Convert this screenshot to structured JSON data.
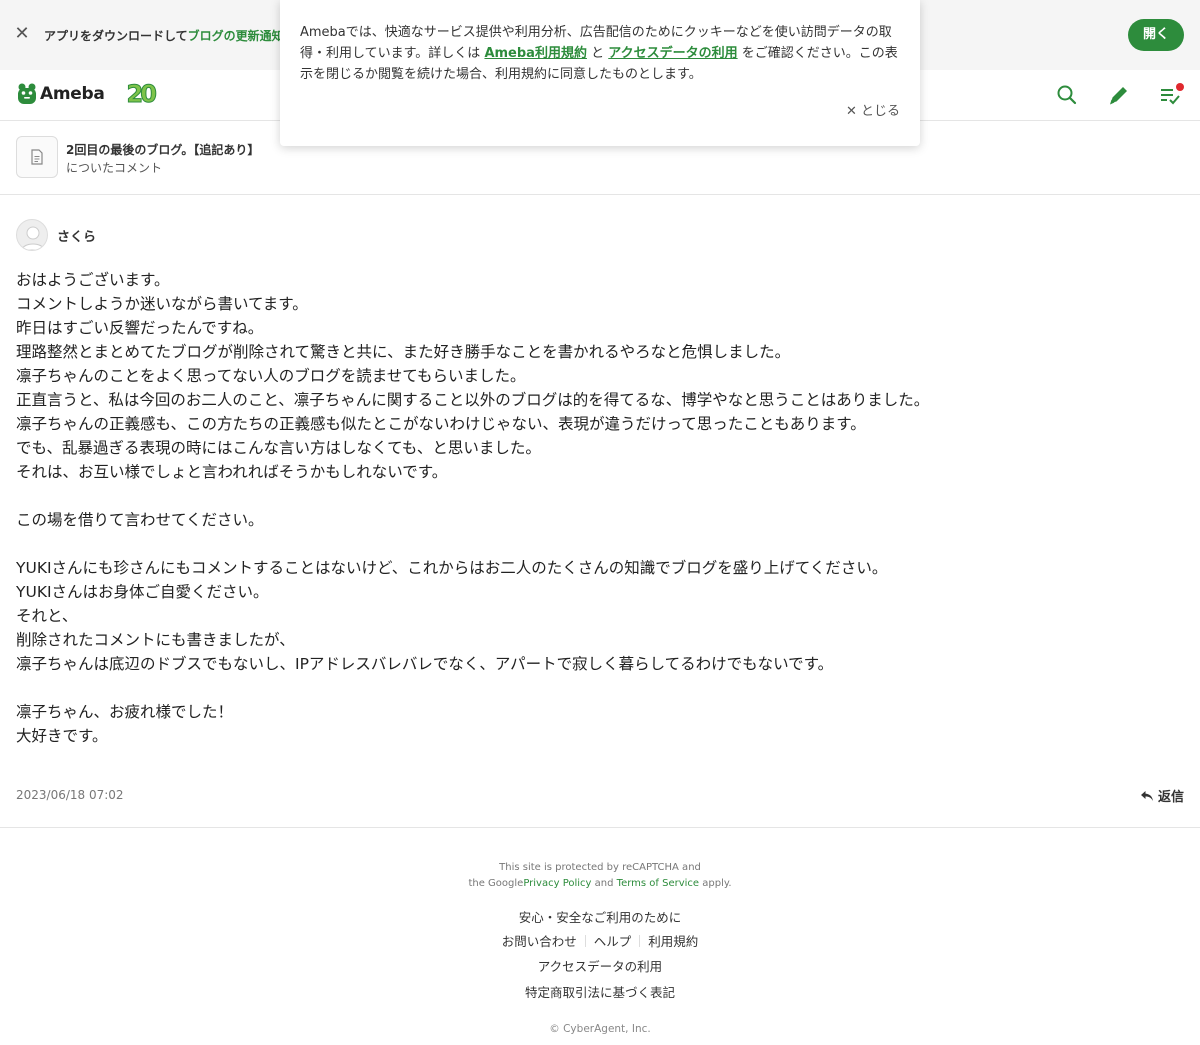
{
  "app_banner": {
    "text_prefix": "アプリをダウンロードして",
    "text_highlight": "ブログの更新通知",
    "open_label": "開く"
  },
  "cookie": {
    "text_1": "Amebaでは、快適なサービス提供や利用分析、広告配信のためにクッキーなどを使い訪問データの取得・利用しています。詳しくは",
    "link_terms": "Ameba利用規約",
    "text_and": "と",
    "link_access": "アクセスデータの利用",
    "text_2": "をご確認ください。この表示を閉じるか閲覧を続けた場合、利用規約に同意したものとします。",
    "close_label": "とじる"
  },
  "header": {
    "logo_text": "Ameba",
    "anniversary": "20"
  },
  "entry": {
    "title": "2回目の最後のブログ。【追記あり】",
    "subtitle": "についたコメント"
  },
  "comment": {
    "author": "さくら",
    "lines": [
      "おはようございます。",
      "コメントしようか迷いながら書いてます。",
      "昨日はすごい反響だったんですね。",
      "理路整然とまとめてたブログが削除されて驚きと共に、また好き勝手なことを書かれるやろなと危惧しました。",
      "凛子ちゃんのことをよく思ってない人のブログを読ませてもらいました。",
      "正直言うと、私は今回のお二人のこと、凛子ちゃんに関すること以外のブログは的を得てるな、博学やなと思うことはありました。",
      "凛子ちゃんの正義感も、この方たちの正義感も似たとこがないわけじゃない、表現が違うだけって思ったこともあります。",
      "でも、乱暴過ぎる表現の時にはこんな言い方はしなくても、と思いました。",
      "それは、お互い様でしょと言われればそうかもしれないです。",
      "",
      "この場を借りて言わせてください。",
      "",
      "YUKIさんにも珍さんにもコメントすることはないけど、これからはお二人のたくさんの知識でブログを盛り上げてください。",
      "YUKIさんはお身体ご自愛ください。",
      "それと、",
      "削除されたコメントにも書きましたが、",
      "凛子ちゃんは底辺のドブスでもないし、IPアドレスバレバレでなく、アパートで寂しく暮らしてるわけでもないです。",
      "",
      "凛子ちゃん、お疲れ様でした！",
      "大好きです。"
    ],
    "date": "2023/06/18 07:02",
    "reply_label": "返信"
  },
  "footer": {
    "recaptcha_1": "This site is protected by reCAPTCHA and",
    "recaptcha_2a": "the Google",
    "privacy": "Privacy Policy",
    "recaptcha_and": "and",
    "terms": "Terms of Service",
    "recaptcha_apply": "apply.",
    "safety": "安心・安全なご利用のために",
    "contact": "お問い合わせ",
    "help": "ヘルプ",
    "tos": "利用規約",
    "access_data": "アクセスデータの利用",
    "commerce": "特定商取引法に基づく表記",
    "copyright": "© CyberAgent, Inc."
  },
  "colors": {
    "brand_green": "#2d8c3c",
    "notification_red": "#e0282e"
  },
  "icons": {
    "banner_close": "close-icon",
    "search": "search-icon",
    "edit": "pencil-icon",
    "notifications": "checklist-icon",
    "entry": "document-icon",
    "reply": "reply-arrow-icon"
  }
}
